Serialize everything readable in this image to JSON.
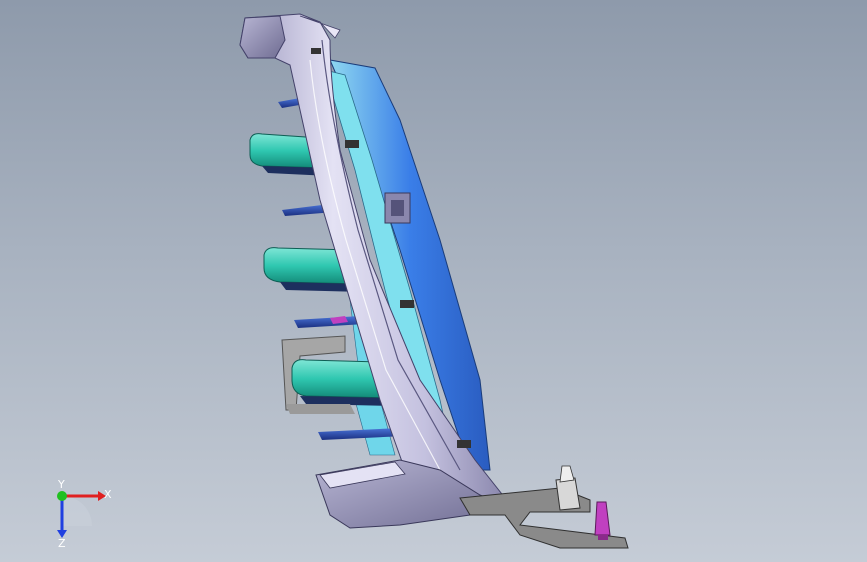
{
  "viewport": {
    "background_top": "#8e9aab",
    "background_bottom": "#c5ccd6"
  },
  "triad": {
    "x_label": "X",
    "y_label": "Y",
    "z_label": "Z",
    "x_color": "#e02020",
    "y_color": "#20c020",
    "z_color": "#2040e0"
  },
  "model": {
    "body_color": "#c9c6e4",
    "blade_color": "#2fc7b0",
    "frame_color": "#3a7ee8",
    "bracket_color": "#8a8a8a",
    "clip_color": "#c040c0",
    "bar_color": "#2a4fb8"
  }
}
